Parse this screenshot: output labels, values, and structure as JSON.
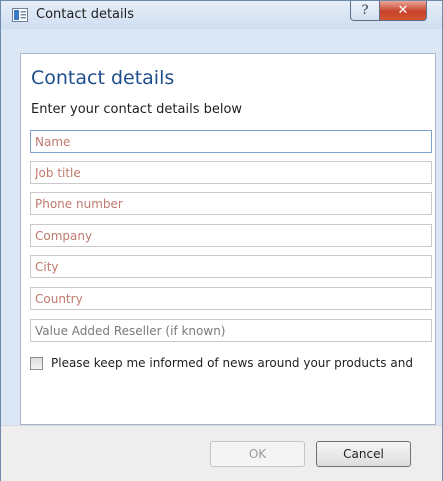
{
  "window": {
    "title": "Contact details",
    "help_glyph": "?",
    "close_glyph": "✕",
    "close_color": "#c8432c"
  },
  "form": {
    "heading": "Contact details",
    "subheading": "Enter your contact details below",
    "fields": {
      "name": {
        "placeholder": "Name"
      },
      "job_title": {
        "placeholder": "Job title"
      },
      "phone": {
        "placeholder": "Phone number"
      },
      "company": {
        "placeholder": "Company"
      },
      "city": {
        "placeholder": "City"
      },
      "country": {
        "placeholder": "Country"
      },
      "reseller": {
        "placeholder": "Value Added Reseller (if known)"
      }
    },
    "consent_label": "Please keep me informed of news around your products and",
    "consent_checked": false
  },
  "buttons": {
    "ok_label": "OK",
    "cancel_label": "Cancel"
  },
  "colors": {
    "heading": "#1f4e8c",
    "placeholder": "#c07a6e"
  }
}
